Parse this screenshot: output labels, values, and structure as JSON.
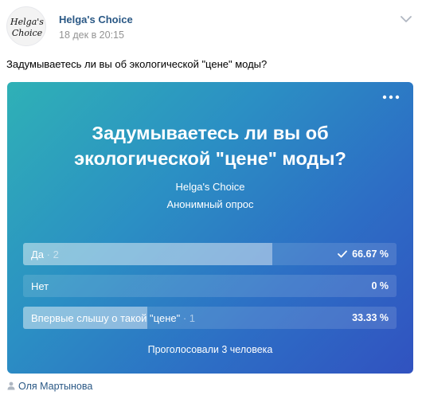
{
  "post": {
    "author": "Helga's Choice",
    "avatar_text_line1": "Helga's",
    "avatar_text_line2": "Choice",
    "date": "18 дек в 20:15",
    "text": "Задумываетесь ли вы об экологической \"цене\" моды?"
  },
  "poll": {
    "title": "Задумываетесь ли вы об экологической \"цене\" моды?",
    "author": "Helga's Choice",
    "type": "Анонимный опрос",
    "answers": [
      {
        "label": "Да",
        "count": "2",
        "percent": "66.67 %",
        "share": 0.6667,
        "chosen": true
      },
      {
        "label": "Нет",
        "count": "",
        "percent": "0 %",
        "share": 0,
        "chosen": false
      },
      {
        "label": "Впервые слышу о такой \"цене\"",
        "count": "1",
        "percent": "33.33 %",
        "share": 0.3333,
        "chosen": false
      }
    ],
    "total": "Проголосовали 3 человека"
  },
  "footer": {
    "signer": "Оля Мартынова"
  },
  "colors": {
    "link": "#2a5885",
    "date": "#939393",
    "gradient_start": "#2fb1b6",
    "gradient_end": "#3152c0"
  },
  "icons": [
    "chevron-down-icon",
    "more-dots-icon",
    "check-icon",
    "person-icon"
  ]
}
